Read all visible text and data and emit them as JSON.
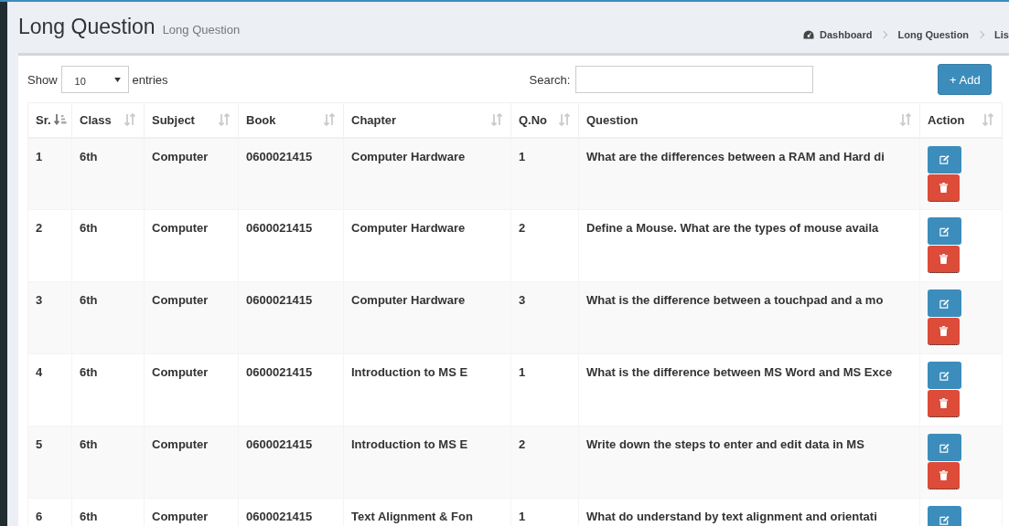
{
  "header": {
    "title": "Long Question",
    "subtitle": "Long Question"
  },
  "breadcrumb": [
    {
      "label": "Dashboard",
      "kind": "home"
    },
    {
      "label": "Long Question",
      "kind": "link"
    },
    {
      "label": "Lis",
      "kind": "current"
    }
  ],
  "controls": {
    "show_label": "Show",
    "page_size": "10",
    "entries_label": "entries",
    "search_label": "Search:",
    "add_button": "+ Add"
  },
  "table": {
    "columns": [
      {
        "label": "Sr.",
        "sorted": true
      },
      {
        "label": "Class",
        "sorted": false
      },
      {
        "label": "Subject",
        "sorted": false
      },
      {
        "label": "Book",
        "sorted": false
      },
      {
        "label": "Chapter",
        "sorted": false
      },
      {
        "label": "Q.No",
        "sorted": false
      },
      {
        "label": "Question",
        "sorted": false
      },
      {
        "label": "Action",
        "sorted": false
      }
    ],
    "rows": [
      {
        "cells": [
          "1",
          "6th",
          "Computer",
          "0600021415",
          "Computer Hardware",
          "1",
          "What are the differences between a RAM and Hard di"
        ],
        "actions": [
          {
            "kind": "edit"
          },
          {
            "kind": "delete"
          }
        ]
      },
      {
        "cells": [
          "2",
          "6th",
          "Computer",
          "0600021415",
          "Computer Hardware",
          "2",
          "Define a Mouse. What are the types of mouse availa"
        ],
        "actions": [
          {
            "kind": "edit"
          },
          {
            "kind": "delete"
          }
        ]
      },
      {
        "cells": [
          "3",
          "6th",
          "Computer",
          "0600021415",
          "Computer Hardware",
          "3",
          "What is the difference between a touchpad and a mo"
        ],
        "actions": [
          {
            "kind": "edit"
          },
          {
            "kind": "delete"
          }
        ]
      },
      {
        "cells": [
          "4",
          "6th",
          "Computer",
          "0600021415",
          "Introduction to MS E",
          "1",
          "What is the difference between MS Word and MS Exce"
        ],
        "actions": [
          {
            "kind": "edit"
          },
          {
            "kind": "delete"
          }
        ]
      },
      {
        "cells": [
          "5",
          "6th",
          "Computer",
          "0600021415",
          "Introduction to MS E",
          "2",
          "Write down the steps to enter and edit data in MS"
        ],
        "actions": [
          {
            "kind": "edit"
          },
          {
            "kind": "delete"
          }
        ]
      },
      {
        "cells": [
          "6",
          "6th",
          "Computer",
          "0600021415",
          "Text Alignment & Fon",
          "1",
          "What do understand by text alignment and orientati"
        ],
        "actions": [
          {
            "kind": "edit"
          }
        ]
      }
    ]
  }
}
